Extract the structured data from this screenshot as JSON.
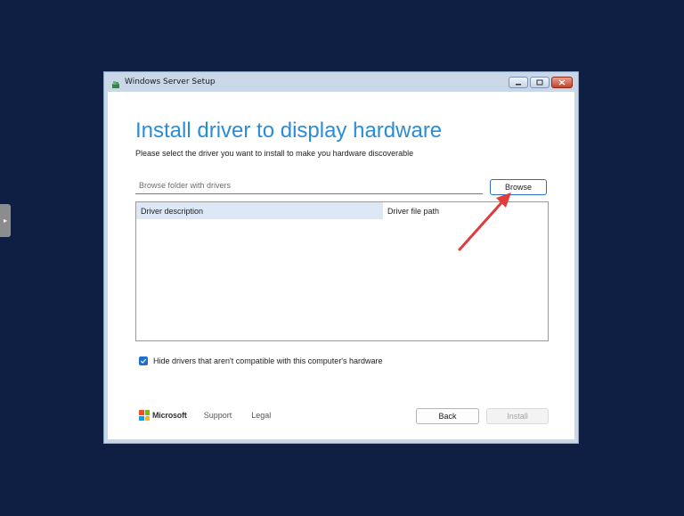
{
  "window": {
    "title": "Windows Server Setup",
    "controls": {
      "minimize_icon": "minimize-icon",
      "restore_icon": "restore-icon",
      "close_icon": "close-icon"
    }
  },
  "page": {
    "heading": "Install driver to display hardware",
    "subheading": "Please select the driver you want to install to make you hardware discoverable"
  },
  "browse": {
    "placeholder": "Browse folder with drivers",
    "button_label": "Browse"
  },
  "driver_table": {
    "columns": [
      "Driver description",
      "Driver file path"
    ],
    "rows": []
  },
  "options": {
    "hide_incompatible_label": "Hide drivers that aren't compatible with this computer's hardware",
    "hide_incompatible_checked": true
  },
  "footer": {
    "brand": "Microsoft",
    "support_label": "Support",
    "legal_label": "Legal",
    "back_label": "Back",
    "install_label": "Install"
  },
  "colors": {
    "desktop_bg": "#0f1f44",
    "heading_blue": "#2b8cd8",
    "annotation_arrow": "#e03c3c",
    "checkbox_blue": "#1f6fd1"
  }
}
